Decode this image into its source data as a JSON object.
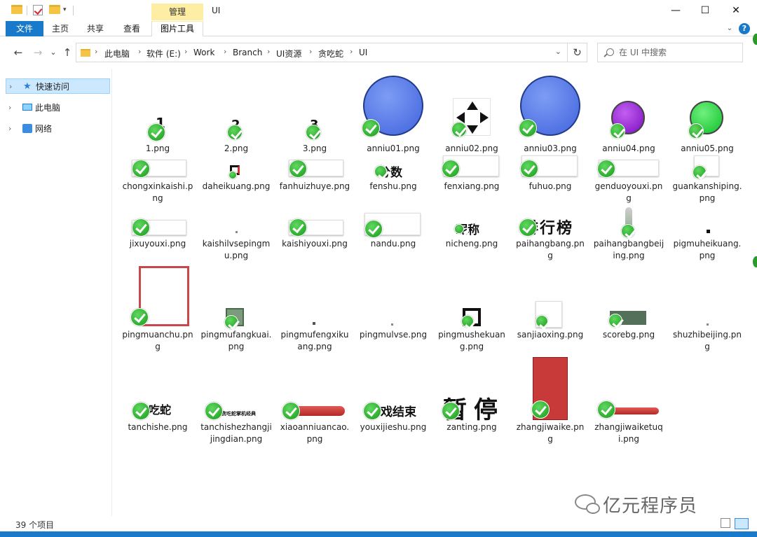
{
  "titlebar": {
    "tool_tab": "管理",
    "title": "UI",
    "minimize": "—",
    "maximize": "☐",
    "close": "✕"
  },
  "ribbon": {
    "tabs": [
      "文件",
      "主页",
      "共享",
      "查看",
      "图片工具"
    ]
  },
  "nav": {
    "back": "←",
    "forward": "→",
    "recent": "⌄",
    "up": "↑",
    "breadcrumbs": [
      "此电脑",
      "软件 (E:)",
      "Work",
      "Branch",
      "UI资源",
      "贪吃蛇",
      "UI"
    ],
    "refresh": "↻",
    "search_placeholder": "在 UI 中搜索"
  },
  "sidebar": {
    "items": [
      {
        "label": "快速访问",
        "selected": true,
        "icon": "star-icon"
      },
      {
        "label": "此电脑",
        "selected": false,
        "icon": "computer-icon"
      },
      {
        "label": "网络",
        "selected": false,
        "icon": "network-icon"
      }
    ]
  },
  "files": [
    {
      "name": "1.png",
      "thumb_text": "1"
    },
    {
      "name": "2.png",
      "thumb_text": "2"
    },
    {
      "name": "3.png",
      "thumb_text": "3"
    },
    {
      "name": "anniu01.png",
      "thumb_color": "#4f78e6"
    },
    {
      "name": "anniu02.png",
      "thumb_icon": "arrows-icon"
    },
    {
      "name": "anniu03.png",
      "thumb_color": "#4f78e6"
    },
    {
      "name": "anniu04.png",
      "thumb_color": "#8e1fd0"
    },
    {
      "name": "anniu05.png",
      "thumb_color": "#1ed63a"
    },
    {
      "name": "chongxinkaishi.png"
    },
    {
      "name": "daheikuang.png"
    },
    {
      "name": "fanhuizhuye.png"
    },
    {
      "name": "fenshu.png",
      "thumb_text": "分数"
    },
    {
      "name": "fenxiang.png"
    },
    {
      "name": "fuhuo.png"
    },
    {
      "name": "genduoyouxi.png"
    },
    {
      "name": "guankanshiping.png"
    },
    {
      "name": "jixuyouxi.png"
    },
    {
      "name": "kaishilvsepingmu.png"
    },
    {
      "name": "kaishiyouxi.png"
    },
    {
      "name": "nandu.png"
    },
    {
      "name": "nicheng.png",
      "thumb_text": "昵称"
    },
    {
      "name": "paihangbang.png",
      "thumb_text": "排行榜"
    },
    {
      "name": "paihangbangbeijing.png"
    },
    {
      "name": "pigmuheikuang.png"
    },
    {
      "name": "pingmuanchu.png"
    },
    {
      "name": "pingmufangkuai.png"
    },
    {
      "name": "pingmufengxikuang.png"
    },
    {
      "name": "pingmulvse.png"
    },
    {
      "name": "pingmushekuang.png"
    },
    {
      "name": "sanjiaoxing.png"
    },
    {
      "name": "scorebg.png"
    },
    {
      "name": "shuzhibeijing.png"
    },
    {
      "name": "tanchishe.png",
      "thumb_text": "贪吃蛇"
    },
    {
      "name": "tanchishezhangjijingdian.png",
      "thumb_text": "贪吃蛇掌机经典"
    },
    {
      "name": "xiaoanniuancao.png"
    },
    {
      "name": "youxijieshu.png",
      "thumb_text": "游戏结束"
    },
    {
      "name": "zanting.png",
      "thumb_text": "暂停"
    },
    {
      "name": "zhangjiwaike.png"
    },
    {
      "name": "zhangjiwaiketuqi.png"
    }
  ],
  "status": {
    "count": "39 个项目"
  },
  "watermark": "亿元程序员",
  "colors": {
    "accent": "#1979ca",
    "tool_tab": "#fdeea4",
    "selected": "#cce8ff",
    "badge": "#22a822"
  }
}
